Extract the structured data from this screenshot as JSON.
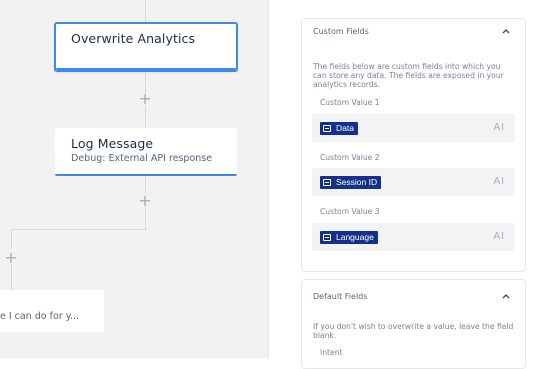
{
  "flow": {
    "nodes": [
      {
        "title": "Overwrite Analytics",
        "subtitle": ""
      },
      {
        "title": "Log Message",
        "subtitle": "Debug: External API response"
      },
      {
        "title": "",
        "subtitle": "e I can do for y..."
      }
    ],
    "add_symbol": "+"
  },
  "panel": {
    "custom_fields": {
      "title": "Custom Fields",
      "description": "The fields below are custom fields into which you can store any data. The fields are exposed in your analytics records.",
      "fields": [
        {
          "label": "Custom Value 1",
          "value": "Data",
          "ai": "AI"
        },
        {
          "label": "Custom Value 2",
          "value": "Session ID",
          "ai": "AI"
        },
        {
          "label": "Custom Value 3",
          "value": "Language",
          "ai": "AI"
        }
      ]
    },
    "default_fields": {
      "title": "Default Fields",
      "description": "If you don't wish to overwrite a value, leave the field blank.",
      "first_label": "Intent"
    }
  },
  "colors": {
    "accent": "#3d8be6",
    "chip": "#14308a",
    "canvas": "#f2f2f3"
  }
}
